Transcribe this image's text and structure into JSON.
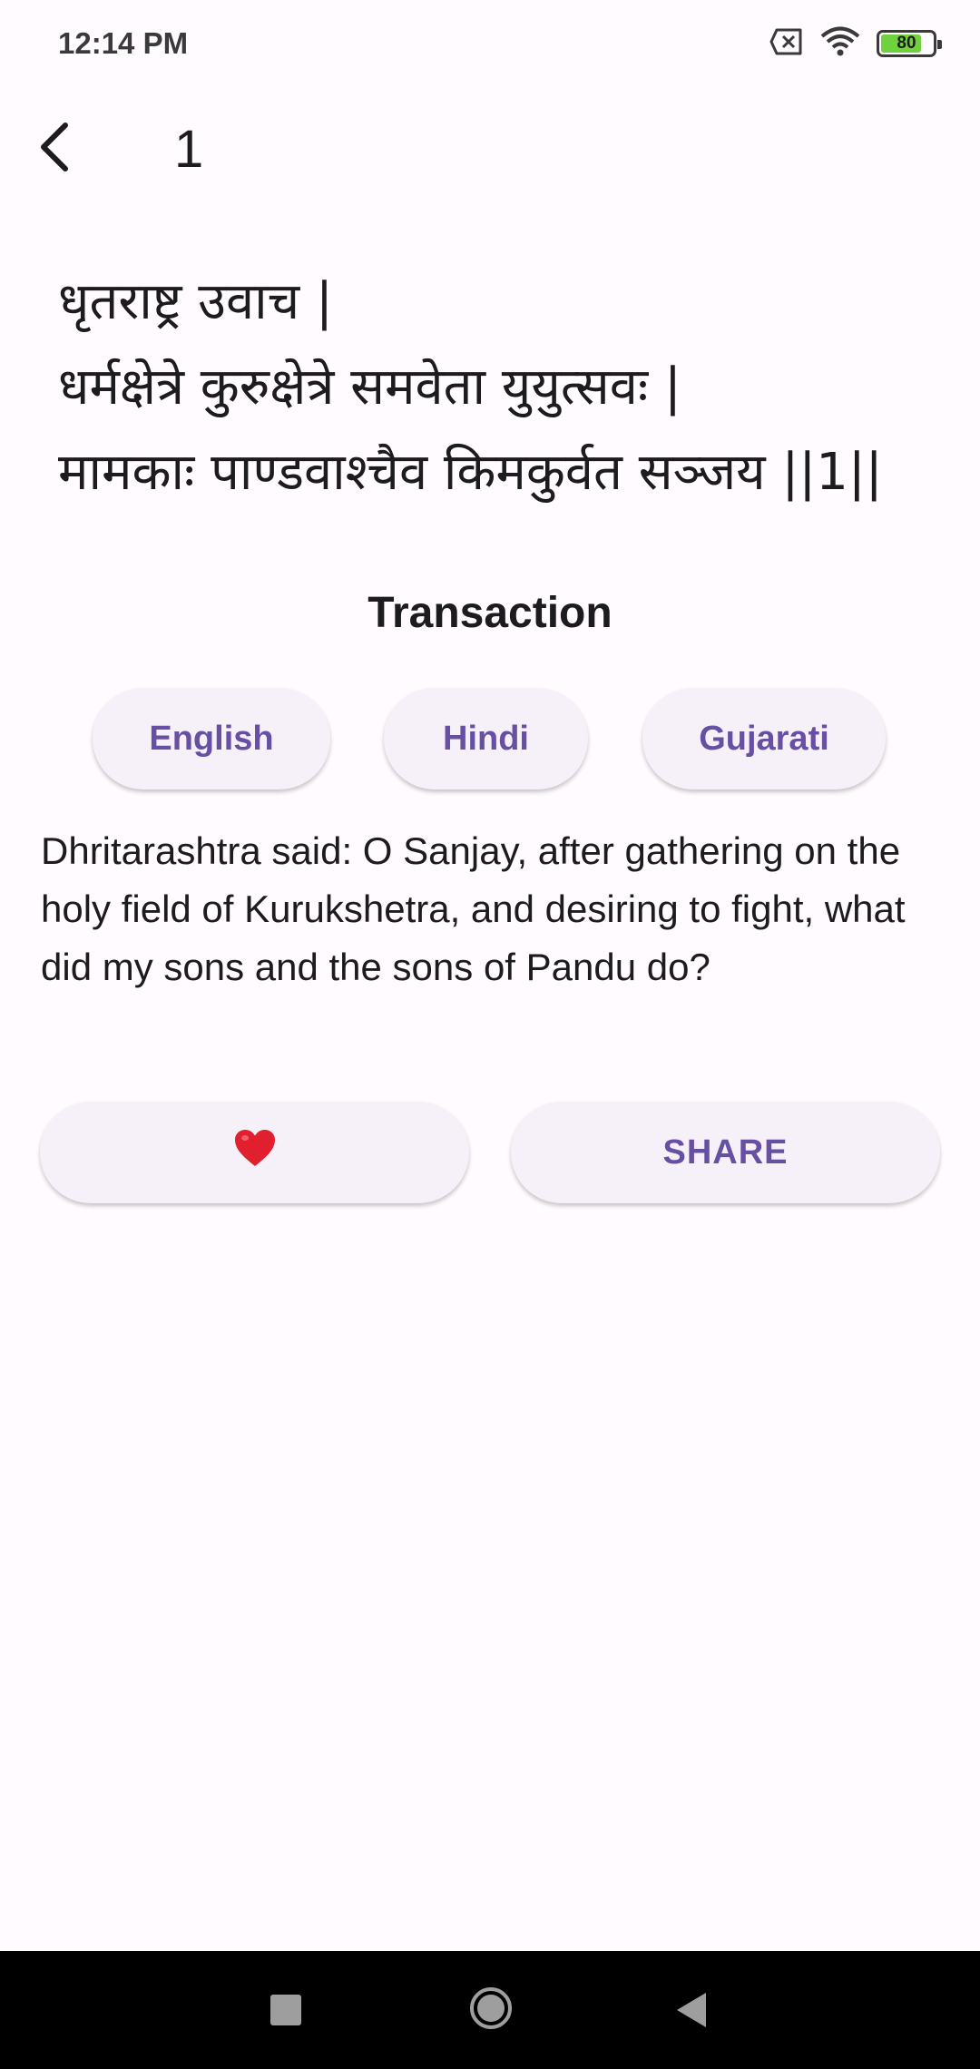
{
  "status_bar": {
    "time": "12:14 PM",
    "battery_level": "80",
    "battery_fraction": 0.8,
    "icons": [
      "sim-off-icon",
      "wifi-icon",
      "battery-icon"
    ]
  },
  "app_bar": {
    "title": "1",
    "back_icon": "chevron-left-icon"
  },
  "verse": {
    "lines": [
      "धृतराष्ट्र उवाच |",
      "धर्मक्षेत्रे कुरुक्षेत्रे समवेता युयुत्सवः |",
      "मामकाः पाण्डवाश्चैव किमकुर्वत सञ्जय ||1||"
    ]
  },
  "section_title": "Transaction",
  "languages": [
    {
      "label": "English"
    },
    {
      "label": "Hindi"
    },
    {
      "label": "Gujarati"
    }
  ],
  "translation_text": "Dhritarashtra said: O Sanjay, after gathering on the holy field of Kurukshetra, and desiring to fight, what did my sons and the sons of Pandu do?",
  "actions": {
    "favorite_icon": "heart-icon",
    "share_label": "SHARE"
  },
  "colors": {
    "accent": "#6750a4",
    "background": "#fffbfe",
    "button_bg": "#f6f1f8",
    "heart": "#e0202e",
    "battery": "#6fd13c"
  },
  "nav_bar": {
    "icons": [
      "recents-icon",
      "home-icon",
      "back-triangle-icon"
    ]
  }
}
